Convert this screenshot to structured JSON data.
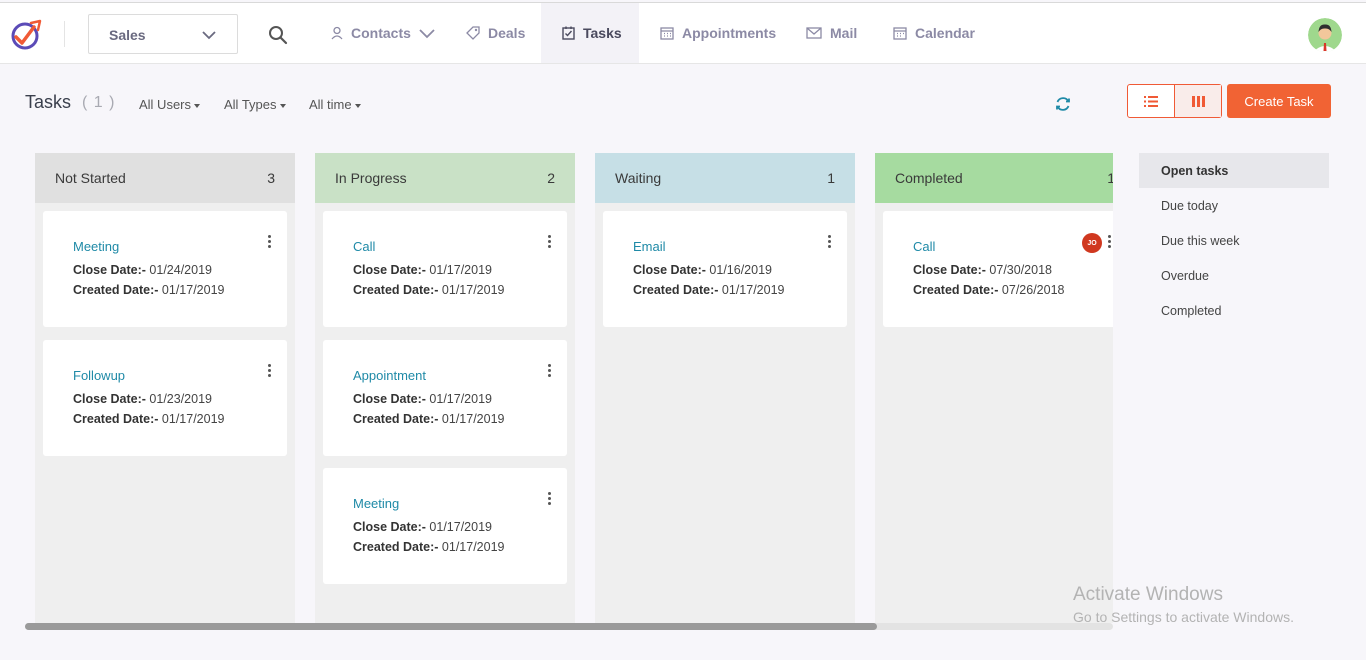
{
  "nav": {
    "pipeline": "Sales",
    "tabs": [
      {
        "label": "Contacts",
        "icon": "user-icon"
      },
      {
        "label": "Deals",
        "icon": "tag-icon"
      },
      {
        "label": "Tasks",
        "icon": "task-check-icon"
      },
      {
        "label": "Appointments",
        "icon": "calendar-grid-icon"
      },
      {
        "label": "Mail",
        "icon": "mail-icon"
      },
      {
        "label": "Calendar",
        "icon": "calendar-icon"
      }
    ],
    "active_tab": "Tasks"
  },
  "header": {
    "title": "Tasks",
    "count": "( 1 )",
    "filters": [
      "All Users",
      "All Types",
      "All time"
    ],
    "create_label": "Create Task"
  },
  "labels": {
    "close": "Close Date:-",
    "created": "Created Date:-"
  },
  "columns": [
    {
      "name": "Not Started",
      "count": "3",
      "color": "#e0e0e0",
      "cards": [
        {
          "title": "Meeting",
          "close": "01/24/2019",
          "created": "01/17/2019"
        },
        {
          "title": "Followup",
          "close": "01/23/2019",
          "created": "01/17/2019"
        }
      ]
    },
    {
      "name": "In Progress",
      "count": "2",
      "color": "#c9e1c6",
      "cards": [
        {
          "title": "Call",
          "close": "01/17/2019",
          "created": "01/17/2019"
        },
        {
          "title": "Appointment",
          "close": "01/17/2019",
          "created": "01/17/2019"
        },
        {
          "title": "Meeting",
          "close": "01/17/2019",
          "created": "01/17/2019"
        }
      ]
    },
    {
      "name": "Waiting",
      "count": "1",
      "color": "#c6dfe6",
      "cards": [
        {
          "title": "Email",
          "close": "01/16/2019",
          "created": "01/17/2019"
        }
      ]
    },
    {
      "name": "Completed",
      "count": "1",
      "color": "#a6dba0",
      "cards": [
        {
          "title": "Call",
          "close": "07/30/2018",
          "created": "07/26/2018",
          "owner": "JO"
        }
      ]
    }
  ],
  "side_filters": [
    "Open tasks",
    "Due today",
    "Due this week",
    "Overdue",
    "Completed"
  ],
  "active_side_filter": "Open tasks",
  "watermark": {
    "line1": "Activate Windows",
    "line2": "Go to Settings to activate Windows."
  }
}
